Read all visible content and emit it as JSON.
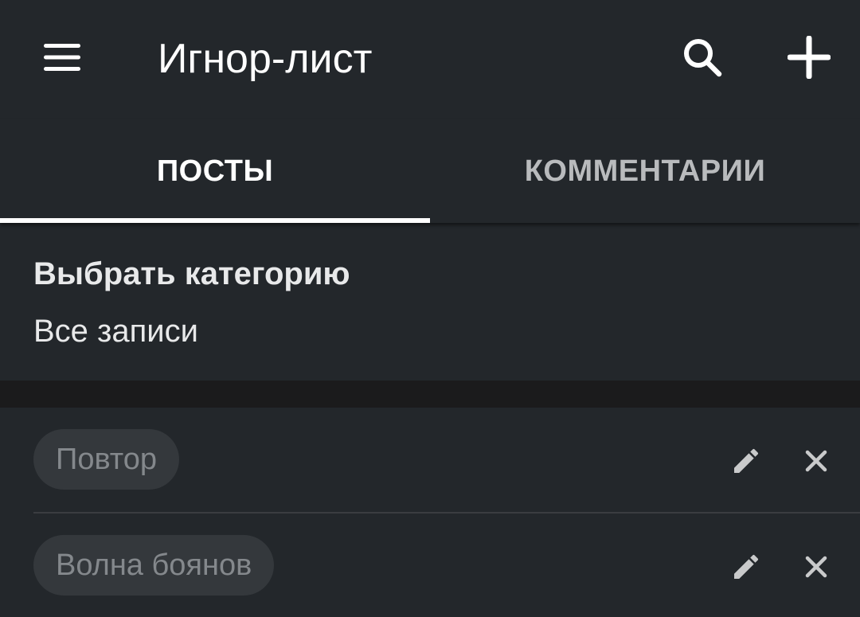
{
  "toolbar": {
    "title": "Игнор-лист",
    "menu_icon": "hamburger-menu-icon",
    "search_icon": "search-icon",
    "add_icon": "plus-icon"
  },
  "tabs": [
    {
      "label": "ПОСТЫ",
      "selected": true
    },
    {
      "label": "КОММЕНТАРИИ",
      "selected": false
    }
  ],
  "category": {
    "heading": "Выбрать категорию",
    "value": "Все записи"
  },
  "items": [
    {
      "label": "Повтор",
      "edit_icon": "pencil-icon",
      "delete_icon": "close-icon"
    },
    {
      "label": "Волна боянов",
      "edit_icon": "pencil-icon",
      "delete_icon": "close-icon"
    }
  ],
  "colors": {
    "surface": "#23272b",
    "background": "#1c1d1f",
    "chip": "#34383c",
    "chip_text": "#84888c",
    "icon_muted": "#c9cacb",
    "selected_tab": "#ffffff"
  }
}
